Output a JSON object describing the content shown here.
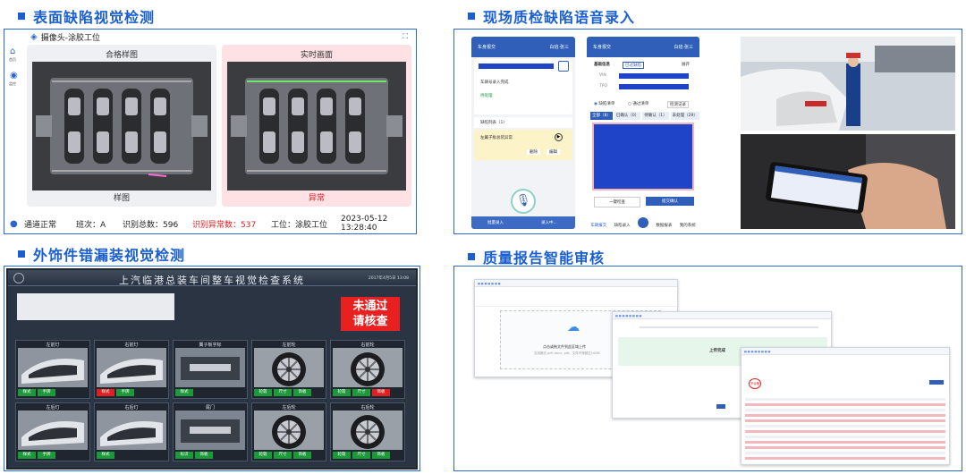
{
  "quadrants": {
    "surface": {
      "title": "表面缺陷视觉检测"
    },
    "voice": {
      "title": "现场质检缺陷语音录入"
    },
    "trim": {
      "title": "外饰件错漏装视觉检测"
    },
    "report": {
      "title": "质量报告智能审核"
    }
  },
  "surface_ui": {
    "camera_label": "摄像头-涂胶工位",
    "nav": [
      "首页",
      "监控"
    ],
    "reference_title": "合格样图",
    "reference_caption": "样图",
    "live_title": "实时画面",
    "live_caption": "异常",
    "status": {
      "channel": "通道正常",
      "shift": "班次：A",
      "total": "识别总数：596",
      "abnormal": "识别异常数：537",
      "station": "工位：涂胶工位",
      "datetime": "2023-05-12 13:28:40"
    },
    "colors": {
      "accent": "#2a66cc",
      "alert": "#e02020",
      "live_bg": "#fde6e8",
      "ref_bg": "#eef0f3"
    }
  },
  "voice_ui": {
    "phone1": {
      "header_left": "车身报交",
      "header_right": "白班·张三",
      "vehicle_done": "车辆号录入完成",
      "pending": "待处理",
      "defect_list": "缺陷列表（1）",
      "defect_item": "左翼子板总装异常",
      "btn_delete": "删除",
      "btn_edit": "编辑",
      "bottom_left": "批量录入",
      "bottom_right": "录入中..."
    },
    "phone2": {
      "header_left": "车身报交",
      "header_right": "白班·张三",
      "section": "基础信息",
      "tag": "已过缺陷",
      "expand": "展开",
      "field1": "VIN",
      "field2": "TPO",
      "radio1": "缺陷清单",
      "radio2": "通过清单",
      "radio3": "检测记录",
      "tabs": [
        "全部（8）",
        "已确认（0）",
        "待确认（1）",
        "未处理（29）"
      ],
      "btn_left": "一键检查",
      "btn_right": "提交确认",
      "nav": [
        "车辆报交",
        "缺陷录入",
        "",
        "数据报表",
        "我的系统"
      ]
    }
  },
  "trim_ui": {
    "system_title": "上汽临港总装车间整车视觉检查系统",
    "datetime": "2017年4月5日 13:08",
    "verdict": "未通过\n请核查",
    "cells": [
      {
        "name": "左前灯",
        "tags": [
          {
            "t": "样式",
            "ng": false
          },
          {
            "t": "手牌",
            "ng": false
          }
        ]
      },
      {
        "name": "右前灯",
        "tags": [
          {
            "t": "样式",
            "ng": true
          },
          {
            "t": "手牌",
            "ng": false
          }
        ]
      },
      {
        "name": "翼子板字标",
        "tags": [
          {
            "t": "样式",
            "ng": false
          }
        ]
      },
      {
        "name": "左前轮",
        "tags": [
          {
            "t": "轮毂",
            "ng": false
          },
          {
            "t": "尺寸",
            "ng": false
          },
          {
            "t": "饰板",
            "ng": false
          }
        ]
      },
      {
        "name": "右前轮",
        "tags": [
          {
            "t": "轮毂",
            "ng": false
          },
          {
            "t": "尺寸",
            "ng": false
          },
          {
            "t": "饰板",
            "ng": true
          }
        ]
      },
      {
        "name": "左后灯",
        "tags": [
          {
            "t": "样式",
            "ng": false
          },
          {
            "t": "手牌",
            "ng": false
          }
        ]
      },
      {
        "name": "右后灯",
        "tags": [
          {
            "t": "样式",
            "ng": false
          }
        ]
      },
      {
        "name": "尾门",
        "tags": [
          {
            "t": "标识",
            "ng": false
          },
          {
            "t": "饰板",
            "ng": false
          }
        ]
      },
      {
        "name": "左后轮",
        "tags": [
          {
            "t": "轮毂",
            "ng": false
          },
          {
            "t": "尺寸",
            "ng": false
          },
          {
            "t": "饰板",
            "ng": false
          }
        ]
      },
      {
        "name": "右后轮",
        "tags": [
          {
            "t": "轮毂",
            "ng": false
          },
          {
            "t": "尺寸",
            "ng": false
          },
          {
            "t": "饰板",
            "ng": false
          }
        ]
      }
    ]
  },
  "report_ui": {
    "upload_text": "点击或拖文件到此区域上传",
    "upload_hint": "支持格式.pdf,.docx,.pdf，文件不得超过100M",
    "upload_done": "上传完成",
    "result_badge": "不合格"
  }
}
